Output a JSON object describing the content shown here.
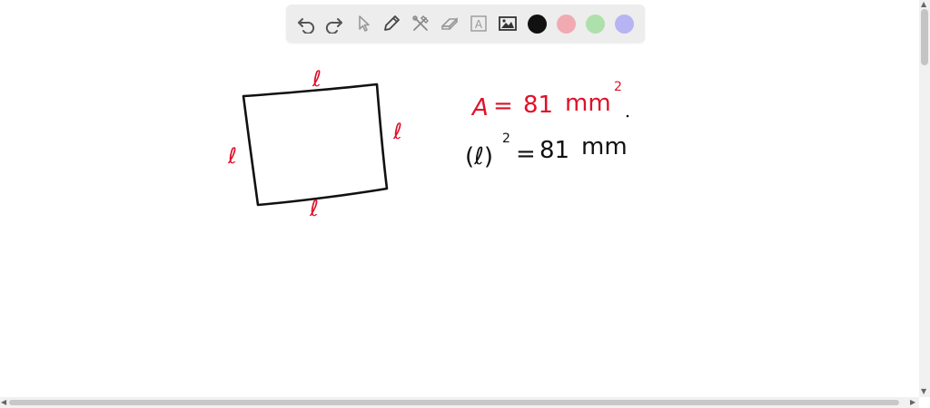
{
  "toolbar": {
    "tools": [
      {
        "name": "undo-icon"
      },
      {
        "name": "redo-icon"
      },
      {
        "name": "pointer-icon"
      },
      {
        "name": "pen-icon"
      },
      {
        "name": "tools-icon"
      },
      {
        "name": "eraser-icon"
      },
      {
        "name": "text-icon",
        "glyph": "A"
      },
      {
        "name": "image-icon"
      }
    ],
    "colors": [
      "#111111",
      "#f2aab2",
      "#aee0ab",
      "#b6b4f2"
    ]
  },
  "canvas": {
    "ink_colors": {
      "red": "#e0102a",
      "black": "#111111"
    },
    "side_labels": [
      "ℓ",
      "ℓ",
      "ℓ",
      "ℓ"
    ],
    "area_line": {
      "A": "A",
      "eq": "=",
      "value": "81",
      "unit": "mm",
      "exp": "2"
    },
    "eq_line": {
      "expr": "(ℓ)",
      "exp": "2",
      "eq": "=",
      "value": "81",
      "unit": "mm"
    }
  }
}
